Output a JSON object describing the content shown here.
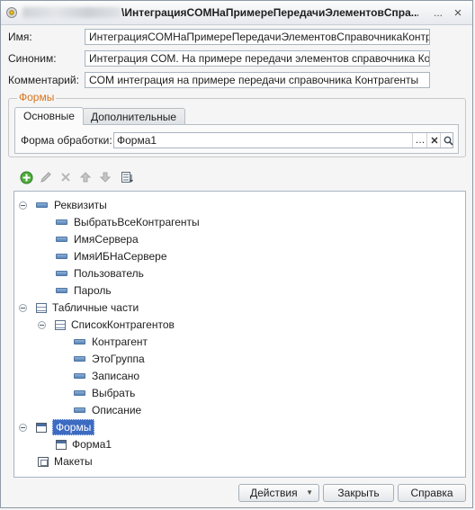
{
  "window": {
    "title": "\\ИнтеграцияCOMНаПримереПередачиЭлементовСпра...",
    "controls": [
      "...",
      "×"
    ]
  },
  "fields": {
    "name_label": "Имя:",
    "name_value": "ИнтеграцияCOMНаПримереПередачиЭлементовСправочникаКонтрагенты",
    "synonym_label": "Синоним:",
    "synonym_value": "Интеграция COM. На примере передачи элементов справочника Контрагенты",
    "comment_label": "Комментарий:",
    "comment_value": "COM интеграция на примере передачи справочника Контрагенты"
  },
  "forms_group": {
    "caption": "Формы",
    "tabs": [
      "Основные",
      "Дополнительные"
    ],
    "processing_form_label": "Форма обработки:",
    "processing_form_value": "Форма1"
  },
  "toolbar": {
    "icons": [
      "add-icon",
      "edit-icon",
      "delete-icon",
      "move-up-icon",
      "move-down-icon",
      "sort-icon"
    ]
  },
  "tree": {
    "requisites": "Реквизиты",
    "requisite_items": [
      "ВыбратьВсеКонтрагенты",
      "ИмяСервера",
      "ИмяИБНаСервере",
      "Пользователь",
      "Пароль"
    ],
    "tabular_parts": "Табличные части",
    "tabular_part_name": "СписокКонтрагентов",
    "tabular_part_items": [
      "Контрагент",
      "ЭтоГруппа",
      "Записано",
      "Выбрать",
      "Описание"
    ],
    "forms": "Формы",
    "form_items": [
      "Форма1"
    ],
    "layouts": "Макеты"
  },
  "buttons": {
    "actions": "Действия",
    "close": "Закрыть",
    "help": "Справка"
  },
  "colors": {
    "selection": "#3d6bc2",
    "group_caption": "#d9731a"
  }
}
